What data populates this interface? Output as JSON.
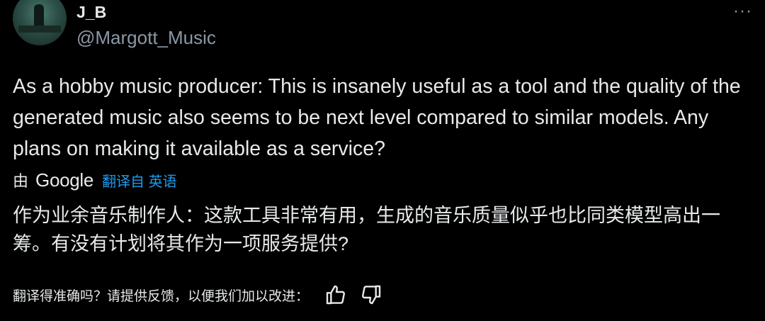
{
  "user": {
    "display_name": "J_B",
    "handle": "@Margott_Music",
    "avatar_icon": "avatar-image"
  },
  "more_icon": "more-options-icon",
  "tweet": {
    "text": "As a hobby music producer: This is insanely useful as a tool and the quality of the generated music also seems to be next level compared to similar models. Any plans on making it available as a service?"
  },
  "translation": {
    "by_label": "由",
    "provider": "Google",
    "link_label": "翻译自 英语",
    "translated_text": "作为业余音乐制作人：这款工具非常有用，生成的音乐质量似乎也比同类模型高出一筹。有没有计划将其作为一项服务提供?"
  },
  "feedback": {
    "prompt": "翻译得准确吗？请提供反馈，以便我们加以改进：",
    "thumbs_up_icon": "thumbs-up-icon",
    "thumbs_down_icon": "thumbs-down-icon"
  },
  "colors": {
    "background": "#000000",
    "text": "#e7e9ea",
    "secondary": "#8b98a5",
    "link": "#1d9bf0"
  }
}
